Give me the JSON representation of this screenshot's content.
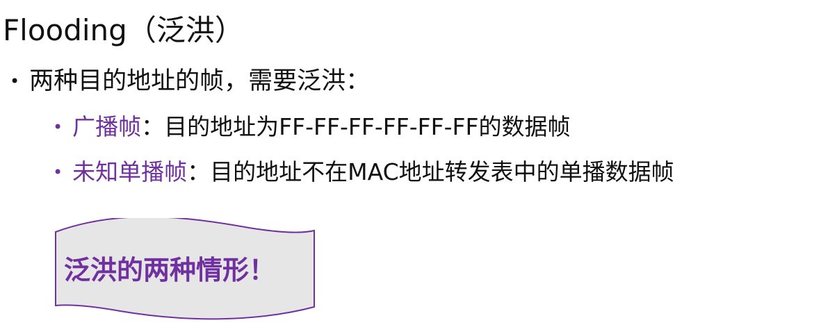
{
  "title": "Flooding（泛洪）",
  "bullet_main": {
    "text": "两种目的地址的帧，需要泛洪："
  },
  "sub_bullets": [
    {
      "term": "广播帧",
      "separator": "：",
      "description": "目的地址为FF-FF-FF-FF-FF-FF的数据帧"
    },
    {
      "term": "未知单播帧",
      "separator": "：",
      "description": "目的地址不在MAC地址转发表中的单播数据帧"
    }
  ],
  "callout": {
    "text": "泛洪的两种情形！"
  },
  "colors": {
    "accent": "#7030a0",
    "text": "#111111",
    "banner_fill": "#e6e6e6"
  }
}
